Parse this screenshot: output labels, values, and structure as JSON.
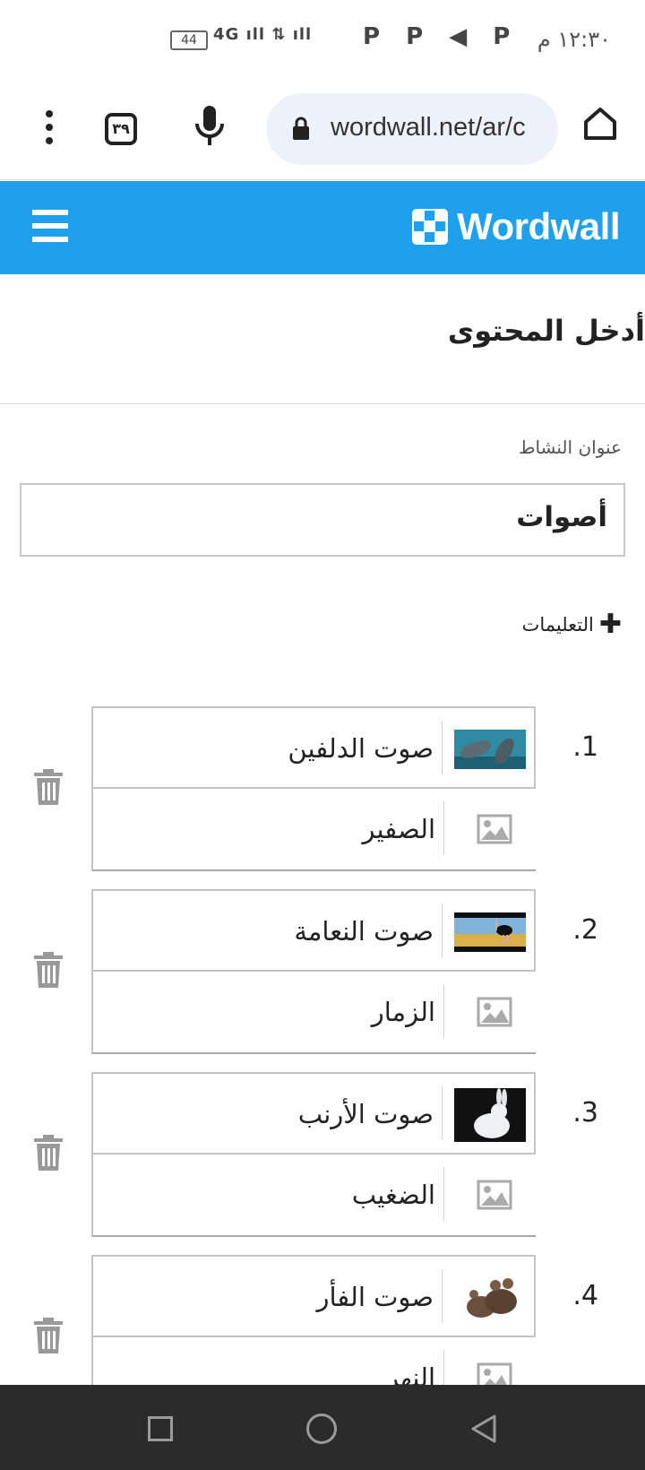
{
  "status_bar": {
    "time": "١٢:٣٠ م",
    "app_icons": "P P ◀ P",
    "battery": "44",
    "network": "4G"
  },
  "browser": {
    "url": "wordwall.net/ar/c",
    "tab_count": "٣٩"
  },
  "header": {
    "logo_text": "Wordwall"
  },
  "page": {
    "title": "أدخل المحتوى",
    "activity_title_label": "عنوان النشاط",
    "activity_title_value": "أصوات",
    "instructions_label": "التعليمات"
  },
  "items": [
    {
      "number": ".1",
      "prompt": "صوت الدلفين",
      "answer": "الصفير",
      "thumb": "dolphins"
    },
    {
      "number": ".2",
      "prompt": "صوت النعامة",
      "answer": "الزمار",
      "thumb": "ostrich"
    },
    {
      "number": ".3",
      "prompt": "صوت الأرنب",
      "answer": "الضغيب",
      "thumb": "rabbit"
    },
    {
      "number": ".4",
      "prompt": "صوت الفأر",
      "answer": "النهر",
      "thumb": "mice"
    }
  ],
  "colors": {
    "header_blue": "#1ea0ec",
    "nav_bar": "#2b2b2b"
  }
}
